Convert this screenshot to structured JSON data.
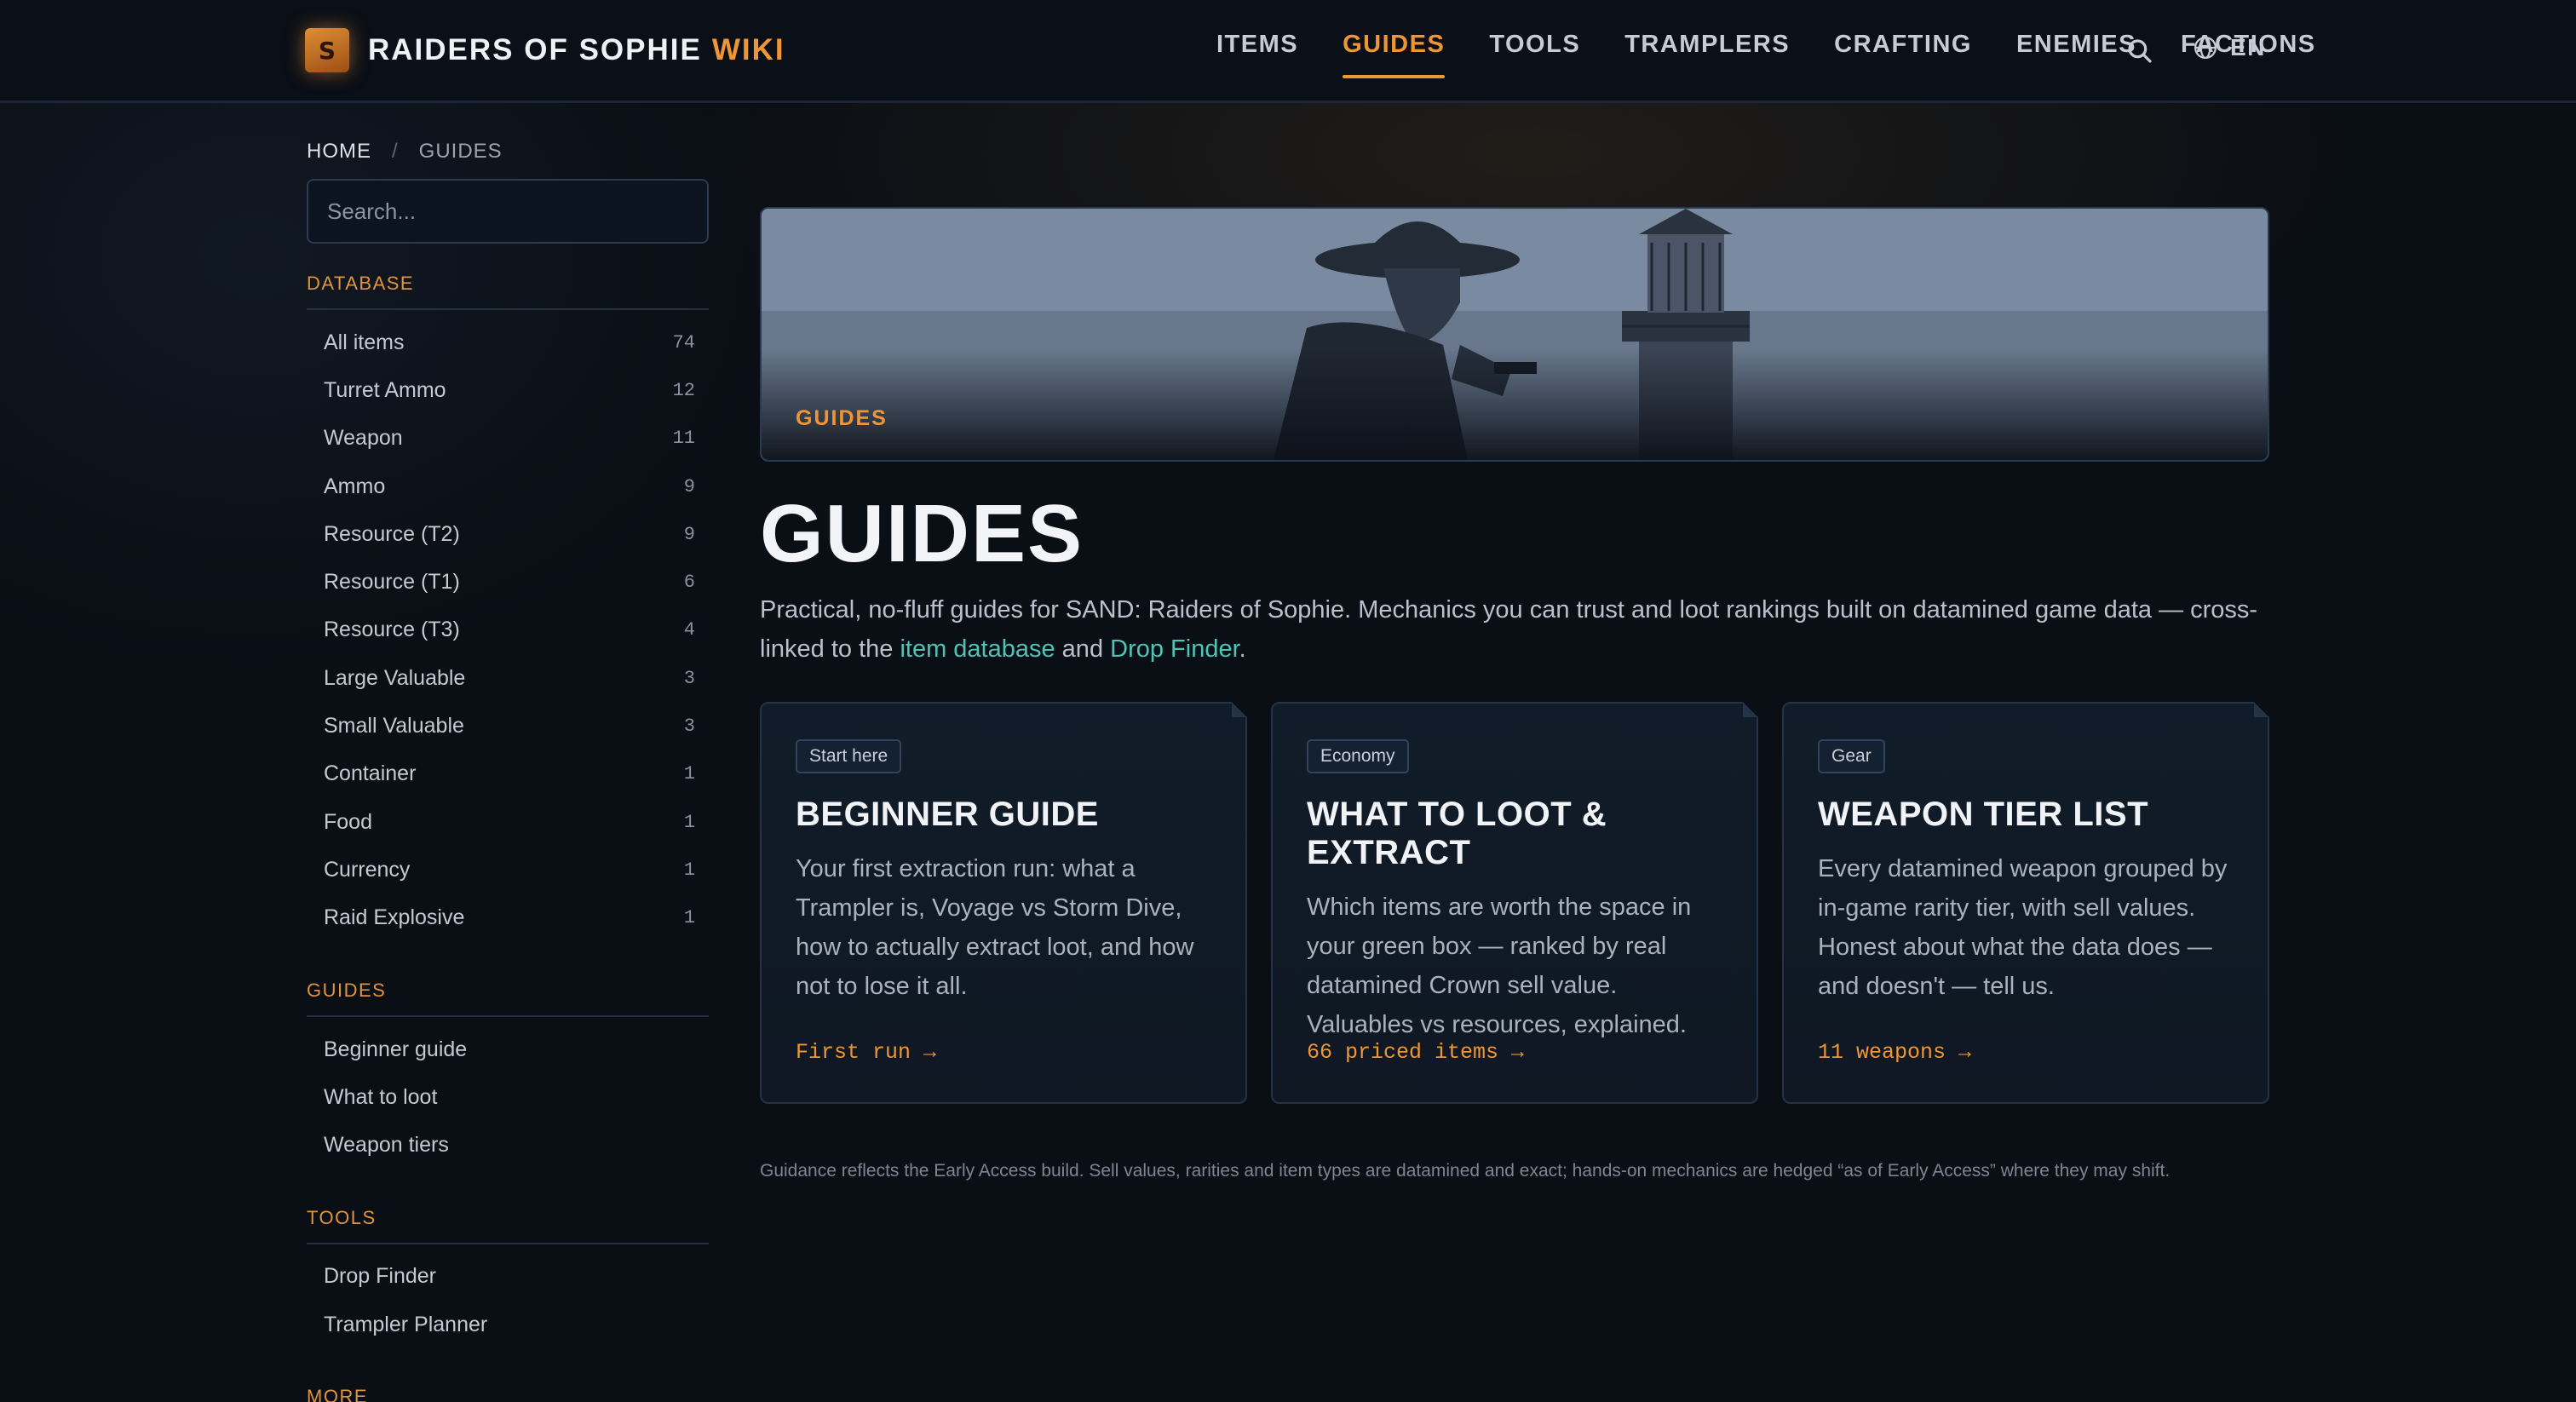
{
  "header": {
    "logo_letter": "S",
    "brand_name": "RAIDERS OF SOPHIE",
    "brand_suffix": "WIKI",
    "nav": [
      "ITEMS",
      "GUIDES",
      "TOOLS",
      "TRAMPLERS",
      "CRAFTING",
      "ENEMIES",
      "FACTIONS"
    ],
    "active_nav": "GUIDES",
    "language": "EN",
    "accent_color": "#ee9636"
  },
  "breadcrumb": {
    "home": "HOME",
    "separator": "/",
    "current": "GUIDES"
  },
  "search": {
    "placeholder": "Search..."
  },
  "sidebar": {
    "database": {
      "title": "DATABASE",
      "items": [
        {
          "label": "All items",
          "count": "74"
        },
        {
          "label": "Turret Ammo",
          "count": "12"
        },
        {
          "label": "Weapon",
          "count": "11"
        },
        {
          "label": "Ammo",
          "count": "9"
        },
        {
          "label": "Resource (T2)",
          "count": "9"
        },
        {
          "label": "Resource (T1)",
          "count": "6"
        },
        {
          "label": "Resource (T3)",
          "count": "4"
        },
        {
          "label": "Large Valuable",
          "count": "3"
        },
        {
          "label": "Small Valuable",
          "count": "3"
        },
        {
          "label": "Container",
          "count": "1"
        },
        {
          "label": "Food",
          "count": "1"
        },
        {
          "label": "Currency",
          "count": "1"
        },
        {
          "label": "Raid Explosive",
          "count": "1"
        }
      ]
    },
    "guides": {
      "title": "GUIDES",
      "items": [
        "Beginner guide",
        "What to loot",
        "Weapon tiers"
      ]
    },
    "tools": {
      "title": "TOOLS",
      "items": [
        "Drop Finder",
        "Trampler Planner"
      ]
    },
    "more": {
      "title": "MORE"
    }
  },
  "hero": {
    "label": "GUIDES"
  },
  "main": {
    "title": "GUIDES",
    "intro_before": "Practical, no-fluff guides for SAND: Raiders of Sophie. Mechanics you can trust and loot rankings built on datamined game data — cross-linked to the ",
    "intro_link1": "item database",
    "intro_mid": " and ",
    "intro_link2": "Drop Finder",
    "intro_after": ".",
    "cards": [
      {
        "tag": "Start here",
        "title": "BEGINNER GUIDE",
        "desc": "Your first extraction run: what a Trampler is, Voyage vs Storm Dive, how to actually extract loot, and how not to lose it all.",
        "link": "First run →"
      },
      {
        "tag": "Economy",
        "title": "WHAT TO LOOT & EXTRACT",
        "desc": "Which items are worth the space in your green box — ranked by real datamined Crown sell value. Valuables vs resources, explained.",
        "link": "66 priced items →"
      },
      {
        "tag": "Gear",
        "title": "WEAPON TIER LIST",
        "desc": "Every datamined weapon grouped by in-game rarity tier, with sell values. Honest about what the data does — and doesn't — tell us.",
        "link": "11 weapons →"
      }
    ],
    "disclaimer": "Guidance reflects the Early Access build. Sell values, rarities and item types are datamined and exact; hands-on mechanics are hedged “as of Early Access” where they may shift."
  }
}
